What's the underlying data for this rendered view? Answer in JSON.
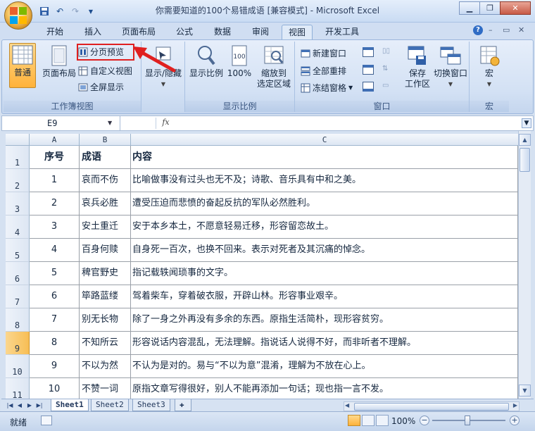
{
  "window": {
    "title": "你需要知道的100个易错成语  [兼容模式] - Microsoft Excel",
    "min_icon": "minimize-icon",
    "restore_icon": "restore-icon",
    "close_icon": "close-icon"
  },
  "quick_access": {
    "save_icon": "save-icon",
    "undo_icon": "undo-icon",
    "redo_icon": "redo-icon",
    "customize_icon": "chevron-down-icon"
  },
  "tabs": [
    {
      "label": "开始"
    },
    {
      "label": "插入"
    },
    {
      "label": "页面布局"
    },
    {
      "label": "公式"
    },
    {
      "label": "数据"
    },
    {
      "label": "审阅"
    },
    {
      "label": "视图",
      "active": true
    },
    {
      "label": "开发工具"
    }
  ],
  "ribbon": {
    "workbook_views": {
      "label": "工作簿视图",
      "normal": "普通",
      "page_layout": "页面布局",
      "page_break_preview": "分页预览",
      "custom_views": "自定义视图",
      "full_screen": "全屏显示"
    },
    "show_hide": {
      "label": "显示/隐藏"
    },
    "zoom": {
      "label": "显示比例",
      "zoom": "显示比例",
      "hundred": "100%",
      "zoom_selection": [
        "缩放到",
        "选定区域"
      ]
    },
    "window": {
      "label": "窗口",
      "new_window": "新建窗口",
      "arrange_all": "全部重排",
      "freeze_panes": "冻结窗格",
      "save_workspace": [
        "保存",
        "工作区"
      ],
      "switch_windows": [
        "切换窗口"
      ]
    },
    "macros": {
      "label": "宏",
      "macros": "宏"
    }
  },
  "formula_bar": {
    "name_box": "E9",
    "fx": "fx",
    "value": ""
  },
  "columns": [
    "A",
    "B",
    "C"
  ],
  "rows": [
    {
      "num": "1",
      "a": "序号",
      "b": "成语",
      "c": "内容",
      "header": true
    },
    {
      "num": "2",
      "a": "1",
      "b": "哀而不伤",
      "c": "比喻做事没有过头也无不及；诗歌、音乐具有中和之美。"
    },
    {
      "num": "3",
      "a": "2",
      "b": "哀兵必胜",
      "c": "遭受压迫而悲愤的奋起反抗的军队必然胜利。"
    },
    {
      "num": "4",
      "a": "3",
      "b": "安土重迁",
      "c": "安于本乡本土，不愿意轻易迁移，形容留恋故土。"
    },
    {
      "num": "5",
      "a": "4",
      "b": "百身何赎",
      "c": "自身死一百次，也换不回来。表示对死者及其沉痛的悼念。"
    },
    {
      "num": "6",
      "a": "5",
      "b": "稗官野史",
      "c": "指记载轶闻琐事的文字。"
    },
    {
      "num": "7",
      "a": "6",
      "b": "筚路蓝缕",
      "c": "驾着柴车，穿着破衣服，开辟山林。形容事业艰辛。"
    },
    {
      "num": "8",
      "a": "7",
      "b": "别无长物",
      "c": "除了一身之外再没有多余的东西。原指生活简朴，现形容贫穷。"
    },
    {
      "num": "9",
      "a": "8",
      "b": "不知所云",
      "c": "形容说话内容混乱，无法理解。指说话人说得不好，而非听者不理解。",
      "selected": true
    },
    {
      "num": "10",
      "a": "9",
      "b": "不以为然",
      "c": "不认为是对的。易与“不以为意”混淆，理解为不放在心上。"
    },
    {
      "num": "11",
      "a": "10",
      "b": "不赞一词",
      "c": "原指文章写得很好，别人不能再添加一句话；现也指一言不发。"
    }
  ],
  "sheets": [
    {
      "label": "Sheet1",
      "active": true
    },
    {
      "label": "Sheet2"
    },
    {
      "label": "Sheet3"
    }
  ],
  "status": {
    "ready": "就绪",
    "zoom": "100%"
  },
  "colors": {
    "accent": "#dfeaf8",
    "highlight_box": "#e02020",
    "selected_row": "#f7be55"
  }
}
